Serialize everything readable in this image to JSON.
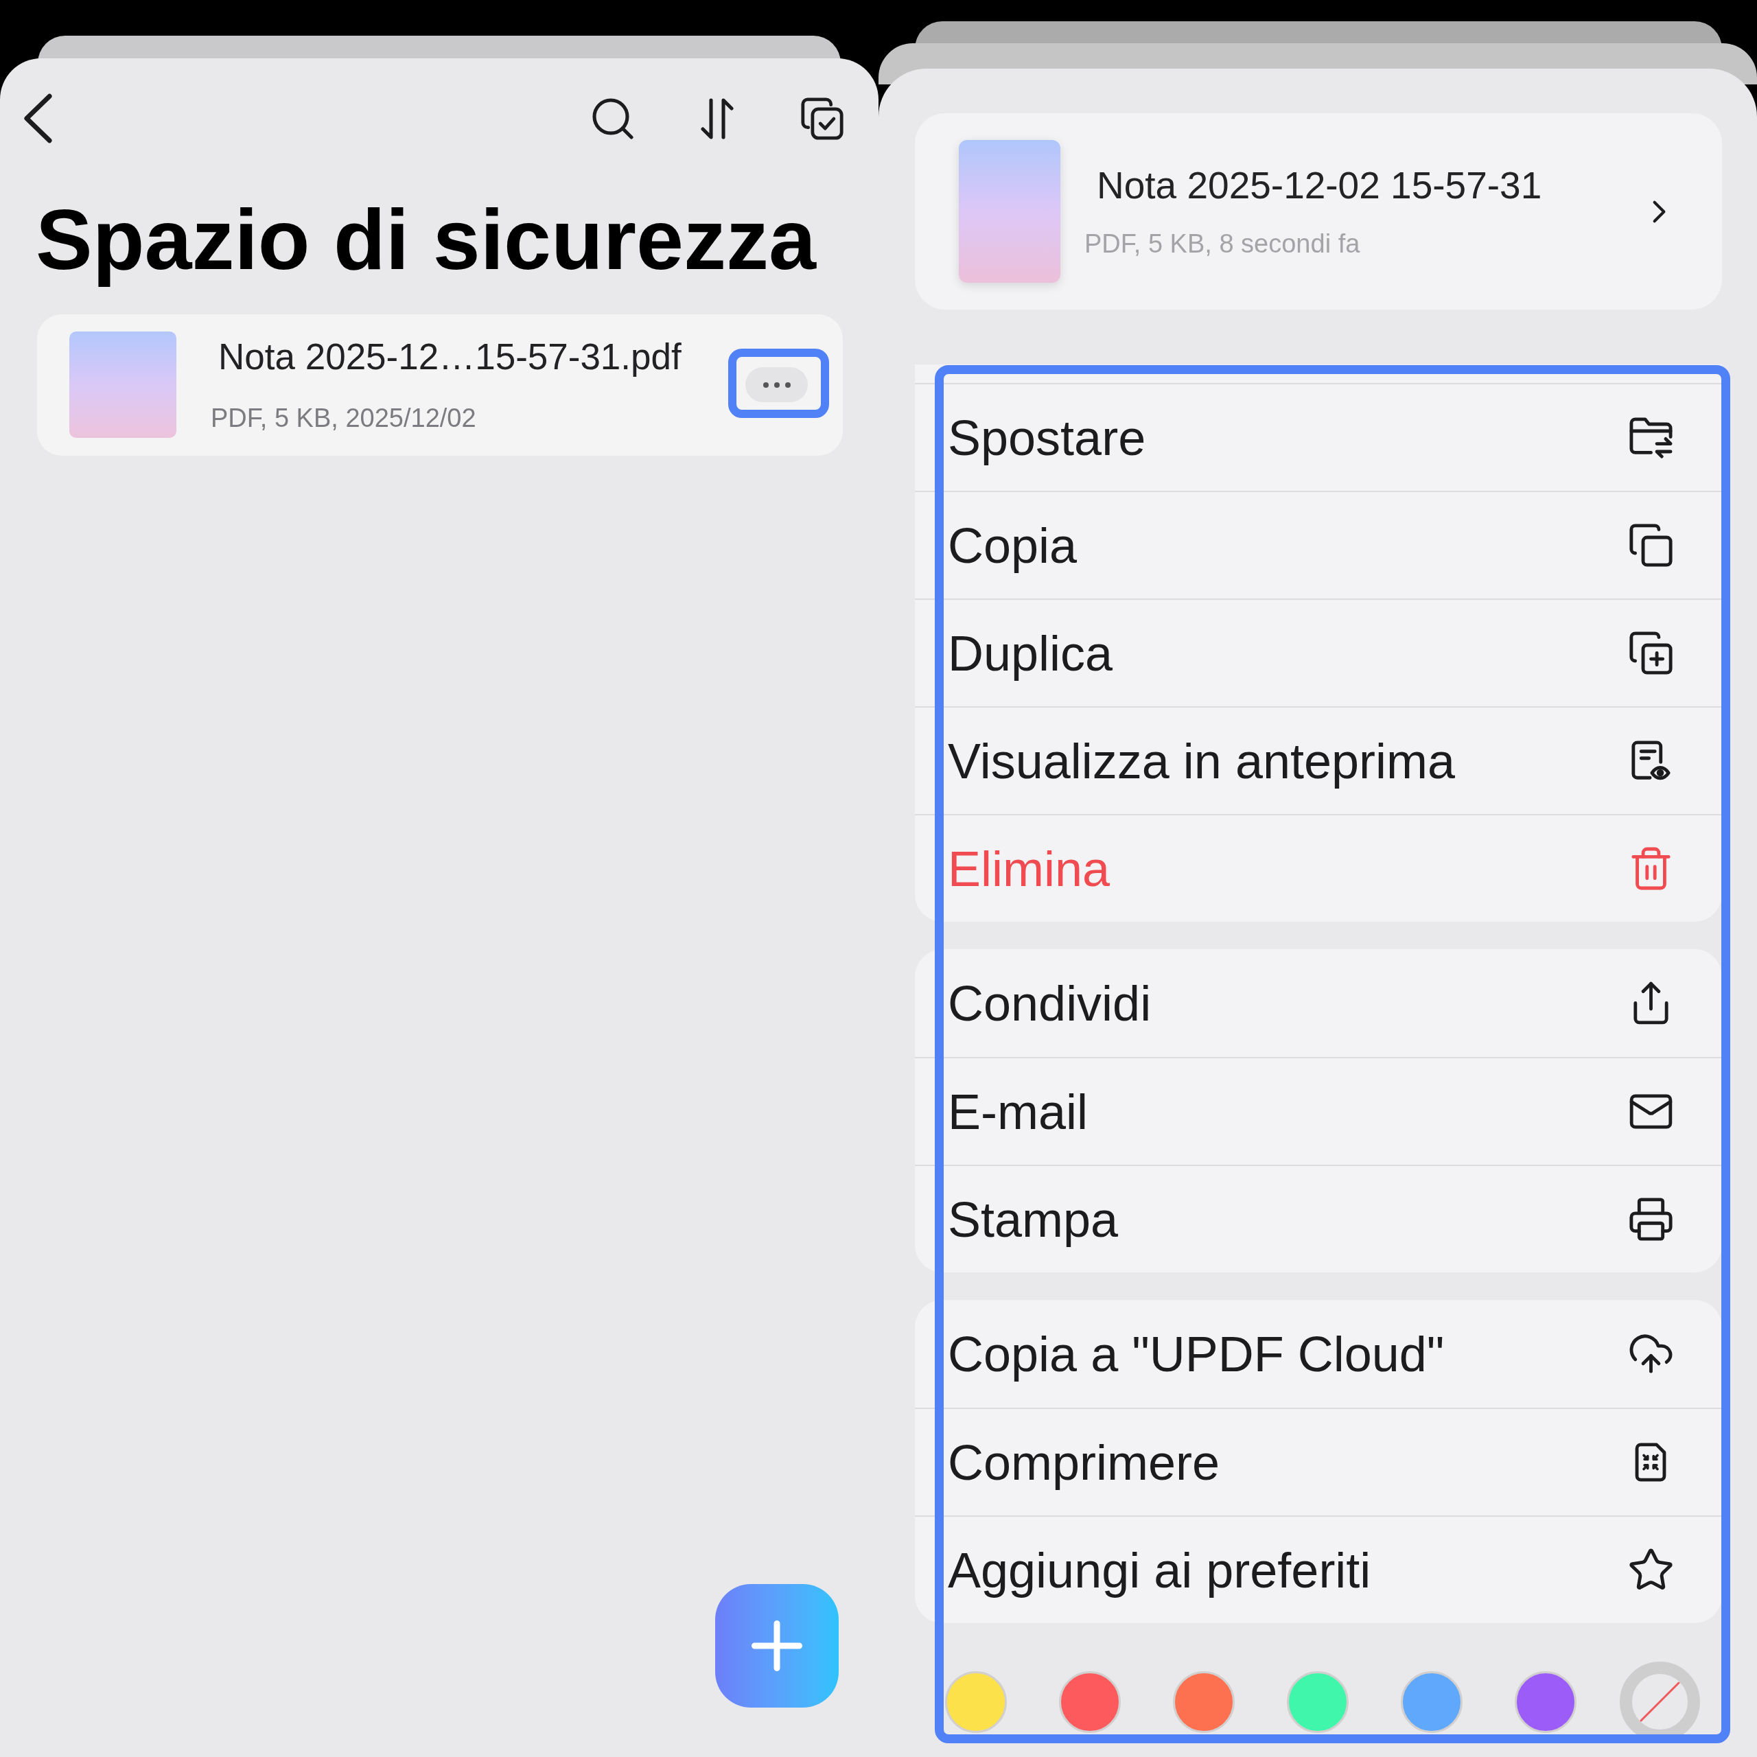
{
  "left_screen": {
    "title": "Spazio di sicurezza",
    "files": [
      {
        "name": "Nota 2025-12…15-57-31.pdf",
        "details": "PDF, 5 KB, 2025/12/02",
        "more_button": {
          "highlighted": true
        }
      }
    ]
  },
  "right_screen": {
    "file": {
      "name": "Nota 2025-12-02 15-57-31",
      "details": "PDF, 5 KB, 8 secondi fa"
    },
    "menu": {
      "highlighted": true,
      "groups": [
        {
          "items": [
            {
              "label": "Spostare",
              "destructive": false
            },
            {
              "label": "Copia",
              "destructive": false
            },
            {
              "label": "Duplica",
              "destructive": false
            },
            {
              "label": "Visualizza in anteprima",
              "destructive": false
            },
            {
              "label": "Elimina",
              "destructive": true
            }
          ]
        },
        {
          "items": [
            {
              "label": "Condividi",
              "destructive": false
            },
            {
              "label": "E-mail",
              "destructive": false
            },
            {
              "label": "Stampa",
              "destructive": false
            }
          ]
        },
        {
          "items": [
            {
              "label": "Copia a \"UPDF Cloud\"",
              "destructive": false
            },
            {
              "label": "Comprimere",
              "destructive": false
            },
            {
              "label": "Aggiungi ai preferiti",
              "destructive": false
            }
          ]
        }
      ],
      "color_tags": [
        {
          "kind": "color",
          "color": "#fce14a"
        },
        {
          "kind": "color",
          "color": "#fd5a5d"
        },
        {
          "kind": "color",
          "color": "#fe7150"
        },
        {
          "kind": "color",
          "color": "#3ff6aa"
        },
        {
          "kind": "color",
          "color": "#5fa8fc"
        },
        {
          "kind": "color",
          "color": "#9b5cf8"
        },
        {
          "kind": "none"
        }
      ]
    }
  }
}
